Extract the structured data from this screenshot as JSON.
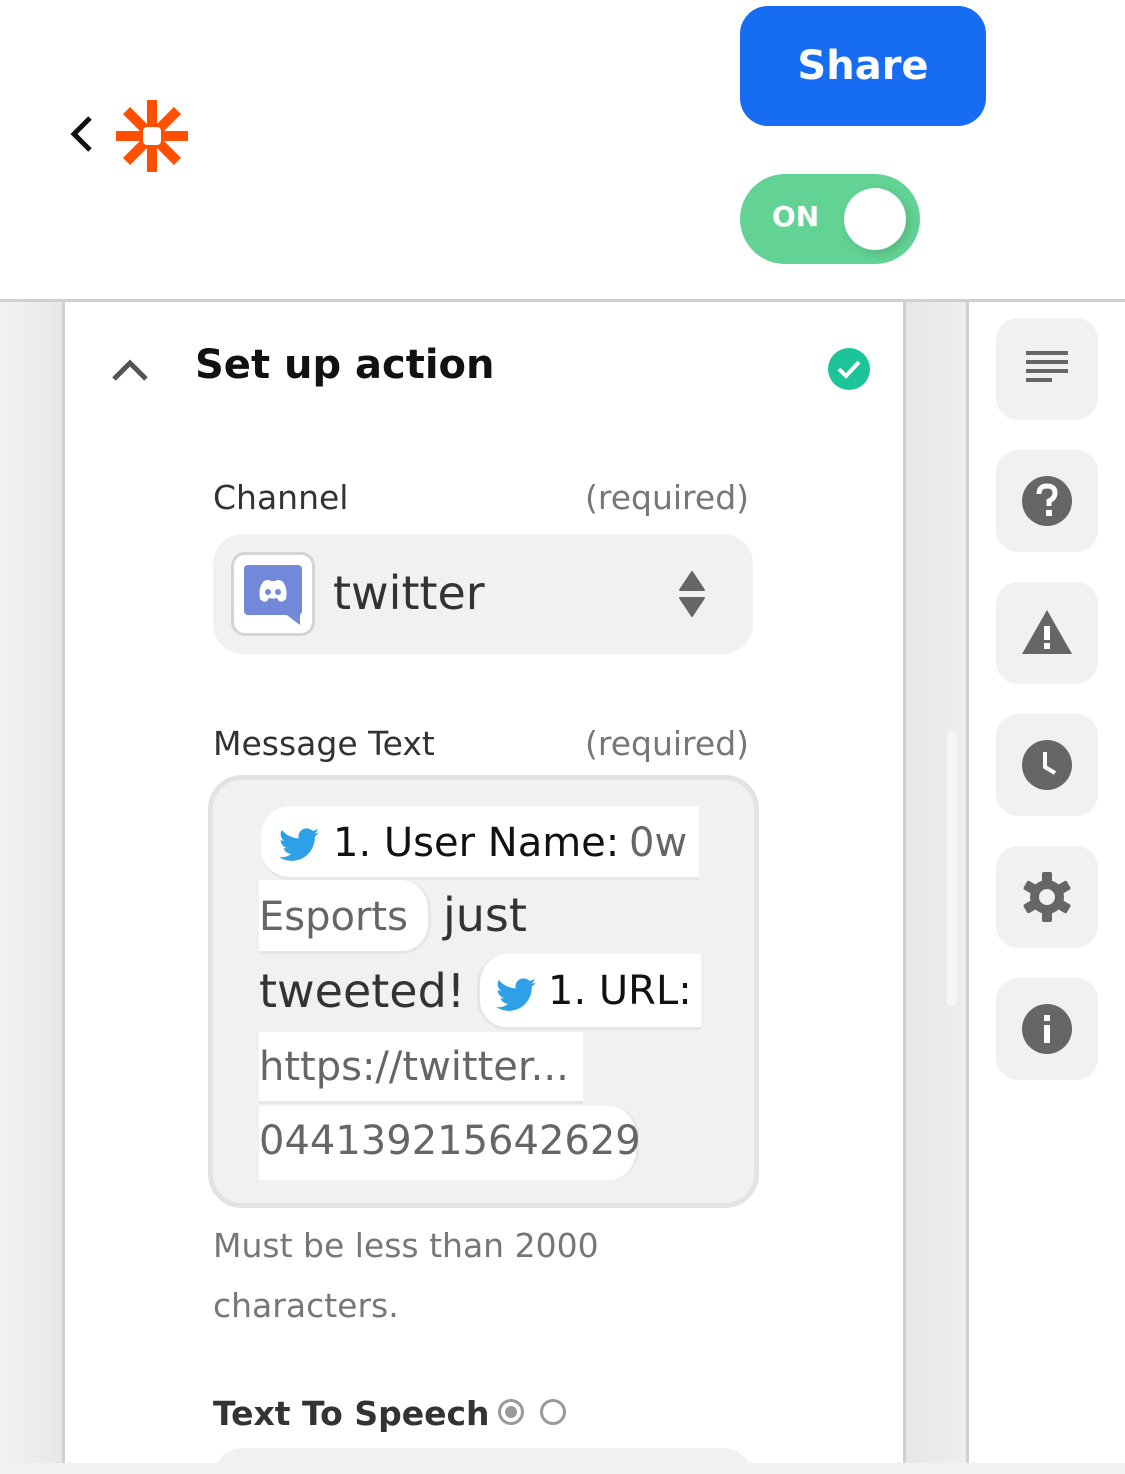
{
  "header": {
    "back_icon": "chevron-left-icon",
    "logo_icon": "zapier-asterisk-logo",
    "share_label": "Share",
    "toggle": {
      "label": "ON",
      "state": true,
      "color": "#62d394"
    },
    "share_color": "#176cf4",
    "logo_color": "#ff4f00"
  },
  "section": {
    "title": "Set up action",
    "collapse_icon": "chevron-up-icon",
    "status_icon": "check-circle-icon",
    "status_color": "#1cc49a"
  },
  "fields": {
    "channel": {
      "label": "Channel",
      "required": "(required)",
      "value": "twitter",
      "app_icon": "discord-icon",
      "control_icon": "sort-arrows-icon"
    },
    "message_text": {
      "label": "Message Text",
      "required": "(required)",
      "tokens": [
        {
          "type": "pill",
          "icon": "twitter-icon",
          "key": "1. User Name:",
          "value": "0w"
        },
        {
          "type": "pill-cont",
          "value": "Esports"
        },
        {
          "type": "text",
          "value": "just"
        },
        {
          "type": "text",
          "value": "tweeted!"
        },
        {
          "type": "pill",
          "icon": "twitter-icon",
          "key": "1. URL:"
        },
        {
          "type": "pill-cont",
          "value": "https://twitter..."
        },
        {
          "type": "pill-cont",
          "value": "044139215642629"
        }
      ],
      "help_line1": "Must be less than 2000",
      "help_line2": "characters."
    },
    "text_to_speech": {
      "label": "Text To Speech",
      "options": [
        {
          "selected": true
        },
        {
          "selected": false
        }
      ]
    }
  },
  "sidebar": {
    "items": [
      {
        "name": "details",
        "icon": "list-lines-icon"
      },
      {
        "name": "help",
        "icon": "help-circle-icon"
      },
      {
        "name": "alerts",
        "icon": "warning-triangle-icon"
      },
      {
        "name": "history",
        "icon": "clock-icon"
      },
      {
        "name": "settings",
        "icon": "gear-icon"
      },
      {
        "name": "info",
        "icon": "info-circle-icon"
      }
    ]
  }
}
